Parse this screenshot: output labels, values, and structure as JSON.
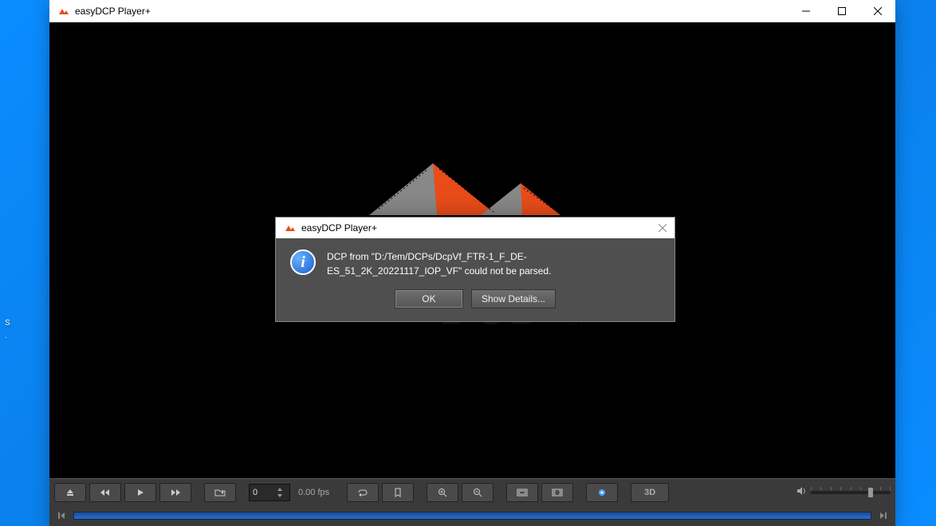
{
  "app": {
    "title": "easyDCP Player+"
  },
  "logo": {
    "text": "easyDCP"
  },
  "toolbar": {
    "frame_value": "0",
    "fps_label": "0.00 fps",
    "threeD_label": "3D"
  },
  "dialog": {
    "title": "easyDCP Player+",
    "message": "DCP from \"D:/Tem/DCPs/DcpVf_FTR-1_F_DE-ES_51_2K_20221117_IOP_VF\" could not be parsed.",
    "ok_label": "OK",
    "details_label": "Show Details..."
  },
  "desktop": {
    "line1": "S",
    "line2": "."
  }
}
